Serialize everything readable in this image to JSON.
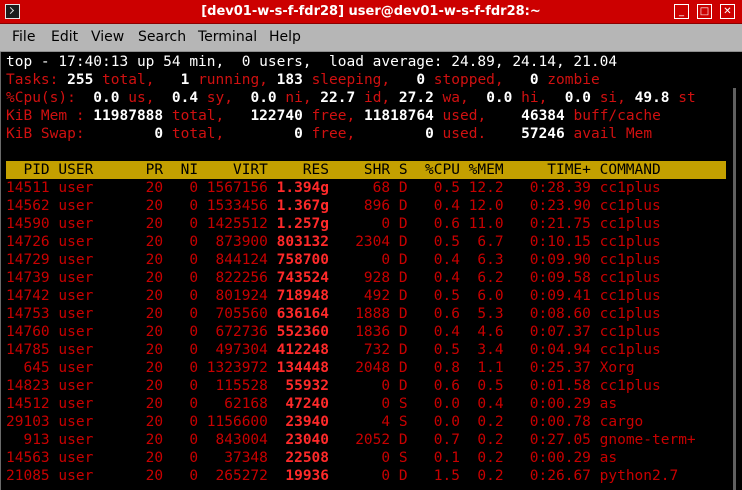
{
  "window": {
    "title": "[dev01-w-s-f-fdr28] user@dev01-w-s-f-fdr28:~",
    "minimize": "_",
    "maximize": "□",
    "close": "✕"
  },
  "menu": [
    "File",
    "Edit",
    "View",
    "Search",
    "Terminal",
    "Help"
  ],
  "summary": {
    "top_line": "top - 17:40:13 up 54 min,  0 users,  load average: 24.89, 24.14, 21.04",
    "tasks": {
      "label": "Tasks:",
      "total": " 255",
      "total_l": " total,",
      "running": "   1",
      "running_l": " running,",
      "sleeping": " 183",
      "sleeping_l": " sleeping,",
      "stopped": "   0",
      "stopped_l": " stopped,",
      "zombie": "   0",
      "zombie_l": " zombie"
    },
    "cpu": {
      "label": "%Cpu(s):",
      "us": "  0.0",
      "us_l": " us,",
      "sy": "  0.4",
      "sy_l": " sy,",
      "ni": "  0.0",
      "ni_l": " ni,",
      "id": " 22.7",
      "id_l": " id,",
      "wa": " 27.2",
      "wa_l": " wa,",
      "hi": "  0.0",
      "hi_l": " hi,",
      "si": "  0.0",
      "si_l": " si,",
      "st": " 49.8",
      "st_l": " st"
    },
    "mem": {
      "label": "KiB Mem :",
      "total": " 11987888",
      "total_l": " total,",
      "free": "   122740",
      "free_l": " free,",
      "used": " 11818764",
      "used_l": " used,",
      "buff": "    46384",
      "buff_l": " buff/cache"
    },
    "swap": {
      "label": "KiB Swap:",
      "total": "        0",
      "total_l": " total,",
      "free": "        0",
      "free_l": " free,",
      "used": "        0",
      "used_l": " used.",
      "avail": "    57246",
      "avail_l": " avail Mem"
    }
  },
  "columns": "  PID USER      PR  NI    VIRT    RES    SHR S  %CPU %MEM     TIME+ COMMAND",
  "processes": [
    {
      "pre": "14511 user      20   0 1567156 ",
      "res": "1.394g",
      "post": "     68 D   0.5 12.2   0:28.39 cc1plus"
    },
    {
      "pre": "14562 user      20   0 1533456 ",
      "res": "1.367g",
      "post": "    896 D   0.4 12.0   0:23.90 cc1plus"
    },
    {
      "pre": "14590 user      20   0 1425512 ",
      "res": "1.257g",
      "post": "      0 D   0.6 11.0   0:21.75 cc1plus"
    },
    {
      "pre": "14726 user      20   0  873900 ",
      "res": "803132",
      "post": "   2304 D   0.5  6.7   0:10.15 cc1plus"
    },
    {
      "pre": "14729 user      20   0  844124 ",
      "res": "758700",
      "post": "      0 D   0.4  6.3   0:09.90 cc1plus"
    },
    {
      "pre": "14739 user      20   0  822256 ",
      "res": "743524",
      "post": "    928 D   0.4  6.2   0:09.58 cc1plus"
    },
    {
      "pre": "14742 user      20   0  801924 ",
      "res": "718948",
      "post": "    492 D   0.5  6.0   0:09.41 cc1plus"
    },
    {
      "pre": "14753 user      20   0  705560 ",
      "res": "636164",
      "post": "   1888 D   0.6  5.3   0:08.60 cc1plus"
    },
    {
      "pre": "14760 user      20   0  672736 ",
      "res": "552360",
      "post": "   1836 D   0.4  4.6   0:07.37 cc1plus"
    },
    {
      "pre": "14785 user      20   0  497304 ",
      "res": "412248",
      "post": "    732 D   0.5  3.4   0:04.94 cc1plus"
    },
    {
      "pre": "  645 user      20   0 1323972 ",
      "res": "134448",
      "post": "   2048 D   0.8  1.1   0:25.37 Xorg"
    },
    {
      "pre": "14823 user      20   0  115528 ",
      "res": " 55932",
      "post": "      0 D   0.6  0.5   0:01.58 cc1plus"
    },
    {
      "pre": "14512 user      20   0   62168 ",
      "res": " 47240",
      "post": "      0 S   0.0  0.4   0:00.29 as"
    },
    {
      "pre": "29103 user      20   0 1156600 ",
      "res": " 23940",
      "post": "      4 S   0.0  0.2   0:00.78 cargo"
    },
    {
      "pre": "  913 user      20   0  843004 ",
      "res": " 23040",
      "post": "   2052 D   0.7  0.2   0:27.05 gnome-term+"
    },
    {
      "pre": "14563 user      20   0   37348 ",
      "res": " 22508",
      "post": "      0 S   0.1  0.2   0:00.29 as"
    },
    {
      "pre": "21085 user      20   0  265272 ",
      "res": " 19936",
      "post": "      0 D   1.5  0.2   0:26.67 python2.7"
    }
  ]
}
